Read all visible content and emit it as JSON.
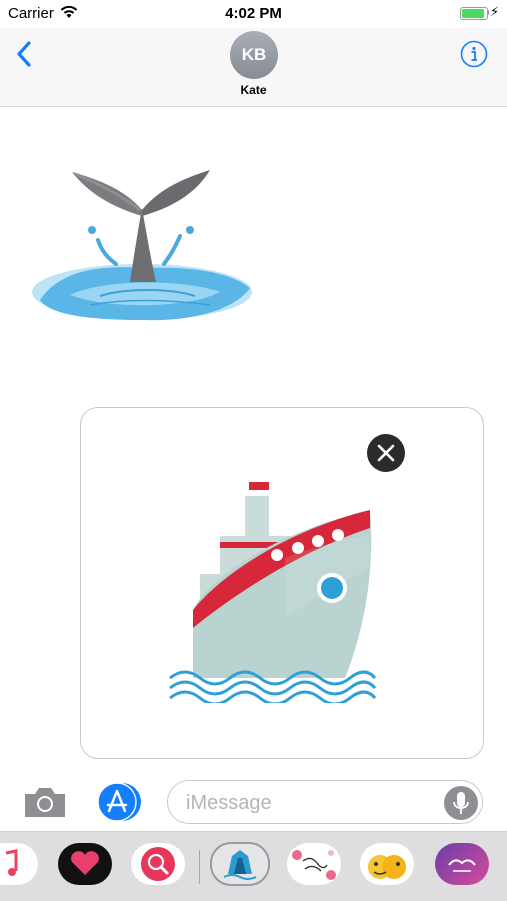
{
  "status_bar": {
    "carrier": "Carrier",
    "time": "4:02 PM"
  },
  "nav": {
    "avatar_initials": "KB",
    "contact_name": "Kate"
  },
  "compose": {
    "placeholder": "iMessage"
  },
  "icons": [
    "chevron-left-icon",
    "info-icon",
    "camera-icon",
    "app-store-icon",
    "microphone-icon",
    "close-icon",
    "wifi-icon",
    "battery-icon"
  ],
  "stickers": [
    "whale-tail-sticker",
    "cruise-ship-sticker"
  ],
  "app_drawer": [
    "music-app",
    "heart-app",
    "search-globe-app",
    "ship-sticker-app",
    "beautiful-day-app",
    "3d-emoji-app",
    "cool-dude-app"
  ],
  "colors": {
    "accent": "#147efb",
    "battery": "#4cd964",
    "ship_red": "#d6283a",
    "water": "#3aa7d8"
  }
}
